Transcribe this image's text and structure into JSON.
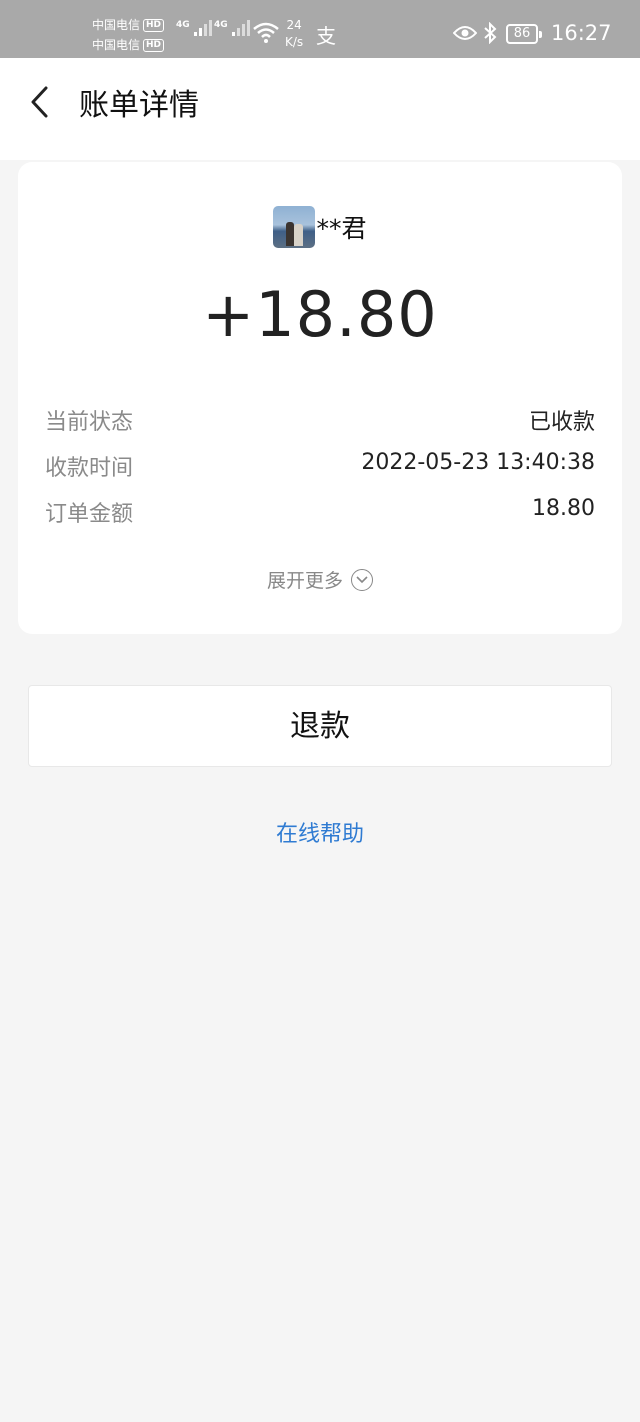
{
  "status_bar": {
    "carrier_1": "中国电信",
    "carrier_2": "中国电信",
    "hd_badge": "HD",
    "network_type": "4G",
    "speed_value": "24",
    "speed_unit": "K/s",
    "pay_icon": "支",
    "battery": "86",
    "time": "16:27"
  },
  "header": {
    "title": "账单详情"
  },
  "payer": {
    "name": "**君"
  },
  "amount": "+18.80",
  "details": [
    {
      "label": "当前状态",
      "value": "已收款"
    },
    {
      "label": "收款时间",
      "value": "2022-05-23 13:40:38"
    },
    {
      "label": "订单金额",
      "value": "18.80"
    }
  ],
  "expand_label": "展开更多",
  "refund_label": "退款",
  "help_label": "在线帮助",
  "colors": {
    "status_bar": "#a9a9a9",
    "background": "#f5f5f5",
    "link": "#2f7bd2"
  }
}
